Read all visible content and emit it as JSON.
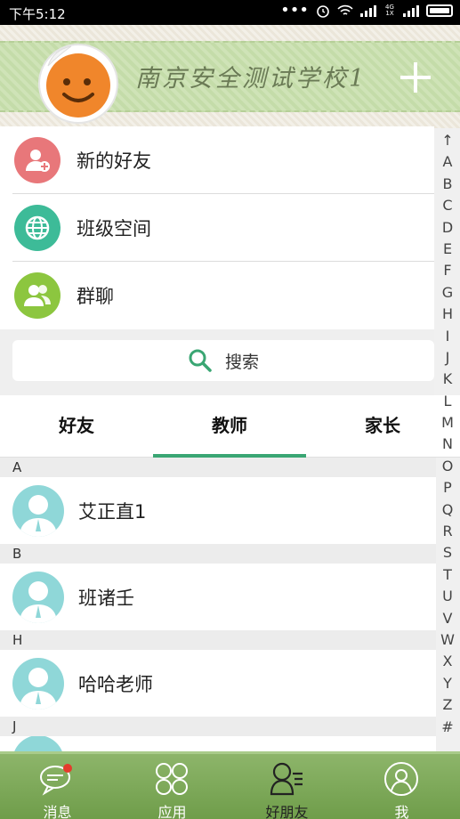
{
  "status_bar": {
    "time": "下午5:12",
    "network": "4G 1X"
  },
  "header": {
    "school_name": "南京安全测试学校1"
  },
  "menu": [
    {
      "label": "新的好友",
      "icon": "add-user-icon",
      "color": "#e8777a"
    },
    {
      "label": "班级空间",
      "icon": "globe-icon",
      "color": "#3dbb98"
    },
    {
      "label": "群聊",
      "icon": "group-icon",
      "color": "#8cc63f"
    }
  ],
  "search": {
    "label": "搜索"
  },
  "tabs": [
    {
      "label": "好友",
      "active": false
    },
    {
      "label": "教师",
      "active": true
    },
    {
      "label": "家长",
      "active": false
    }
  ],
  "contacts": [
    {
      "letter": "A",
      "name": "艾正直1"
    },
    {
      "letter": "B",
      "name": "班诸壬"
    },
    {
      "letter": "H",
      "name": "哈哈老师"
    },
    {
      "letter": "J",
      "name": ""
    }
  ],
  "index_letters": [
    "↑",
    "A",
    "B",
    "C",
    "D",
    "E",
    "F",
    "G",
    "H",
    "I",
    "J",
    "K",
    "L",
    "M",
    "N",
    "O",
    "P",
    "Q",
    "R",
    "S",
    "T",
    "U",
    "V",
    "W",
    "X",
    "Y",
    "Z",
    "#"
  ],
  "bottom_nav": [
    {
      "label": "消息",
      "icon": "chat-bubble-icon",
      "badge": true
    },
    {
      "label": "应用",
      "icon": "apps-grid-icon"
    },
    {
      "label": "好朋友",
      "icon": "contacts-icon",
      "active": true
    },
    {
      "label": "我",
      "icon": "profile-icon"
    }
  ],
  "colors": {
    "accent": "#3aa673",
    "nav_bg": "#7ea85a",
    "badge": "#e53b2c"
  }
}
